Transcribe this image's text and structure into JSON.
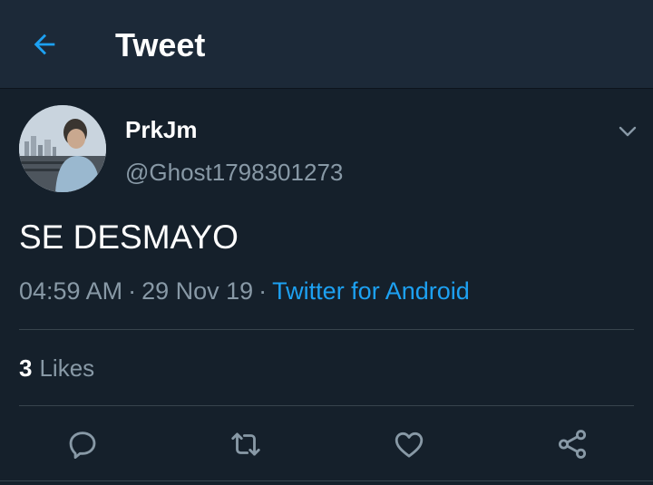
{
  "header": {
    "back_icon": "arrow-left-icon",
    "title": "Tweet"
  },
  "tweet": {
    "display_name": "PrkJm",
    "handle": "@Ghost1798301273",
    "text": "SE DESMAYO",
    "time": "04:59 AM",
    "date": "29 Nov 19",
    "separator": "·",
    "source": "Twitter for Android",
    "likes_count": "3",
    "likes_label": "Likes"
  },
  "actions": [
    {
      "name": "reply",
      "icon": "reply-icon"
    },
    {
      "name": "retweet",
      "icon": "retweet-icon"
    },
    {
      "name": "like",
      "icon": "heart-icon"
    },
    {
      "name": "share",
      "icon": "share-icon"
    }
  ],
  "colors": {
    "background": "#15202b",
    "header": "#1c2938",
    "accent": "#1da1f2",
    "secondary_text": "#8899a6",
    "divider": "#38444d"
  }
}
